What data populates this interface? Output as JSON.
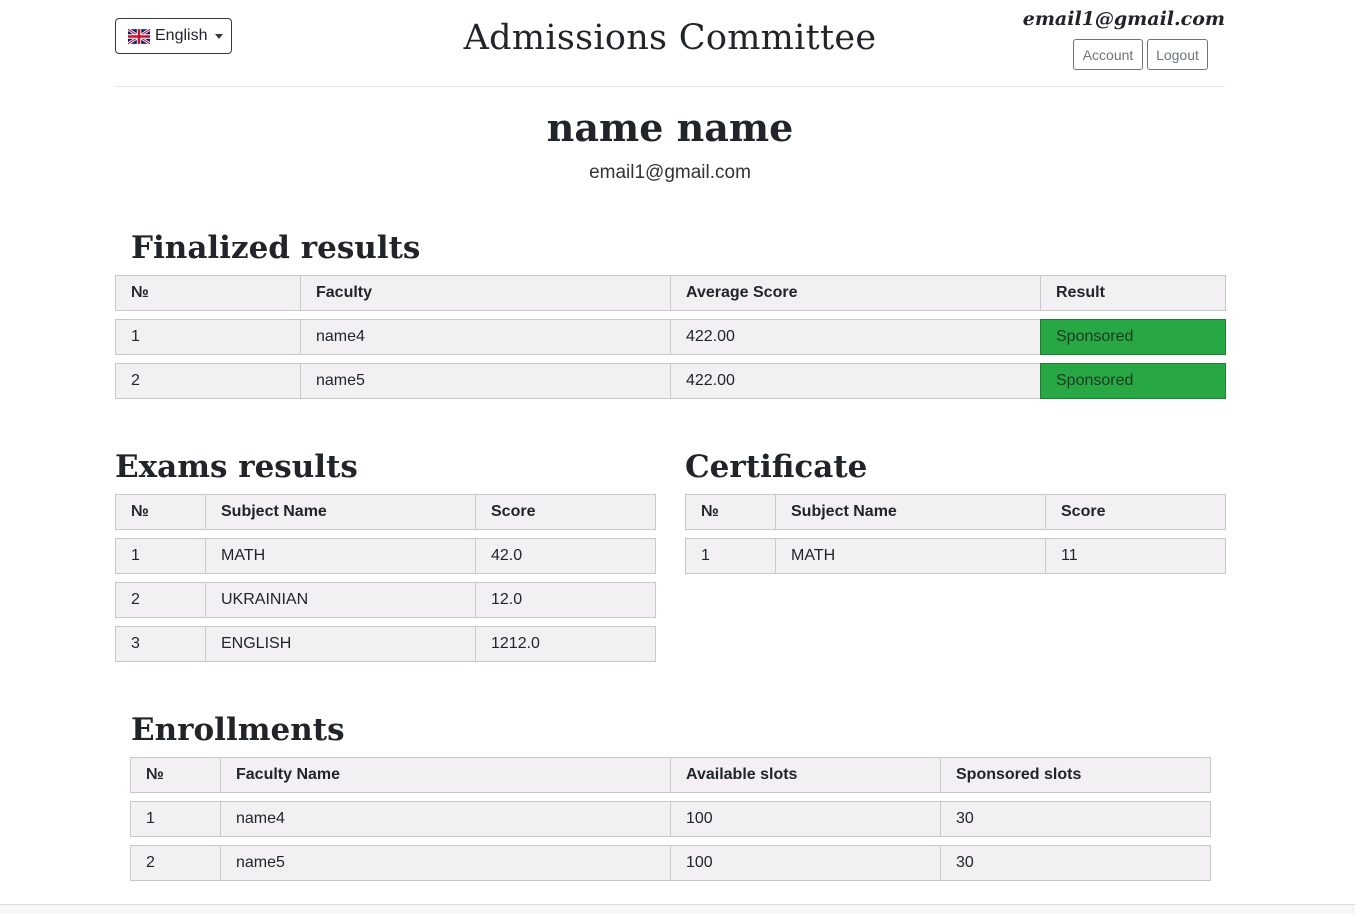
{
  "header": {
    "language": "English",
    "title": "Admissions Committee",
    "user_email": "email1@gmail.com",
    "account_label": "Account",
    "logout_label": "Logout"
  },
  "profile": {
    "name": "name name",
    "email": "email1@gmail.com"
  },
  "finalized": {
    "title": "Finalized results",
    "headers": [
      "№",
      "Faculty",
      "Average Score",
      "Result"
    ],
    "rows": [
      [
        "1",
        "name4",
        "422.00",
        "Sponsored"
      ],
      [
        "2",
        "name5",
        "422.00",
        "Sponsored"
      ]
    ]
  },
  "exams": {
    "title": "Exams results",
    "headers": [
      "№",
      "Subject Name",
      "Score"
    ],
    "rows": [
      [
        "1",
        "MATH",
        "42.0"
      ],
      [
        "2",
        "UKRAINIAN",
        "12.0"
      ],
      [
        "3",
        "ENGLISH",
        "1212.0"
      ]
    ]
  },
  "certificate": {
    "title": "Certificate",
    "headers": [
      "№",
      "Subject Name",
      "Score"
    ],
    "rows": [
      [
        "1",
        "MATH",
        "11"
      ]
    ]
  },
  "enrollments": {
    "title": "Enrollments",
    "headers": [
      "№",
      "Faculty Name",
      "Available slots",
      "Sponsored slots"
    ],
    "rows": [
      [
        "1",
        "name4",
        "100",
        "30"
      ],
      [
        "2",
        "name5",
        "100",
        "30"
      ]
    ]
  },
  "colors": {
    "sponsored": "#28a745",
    "cell_bg": "#f2f0f3"
  }
}
